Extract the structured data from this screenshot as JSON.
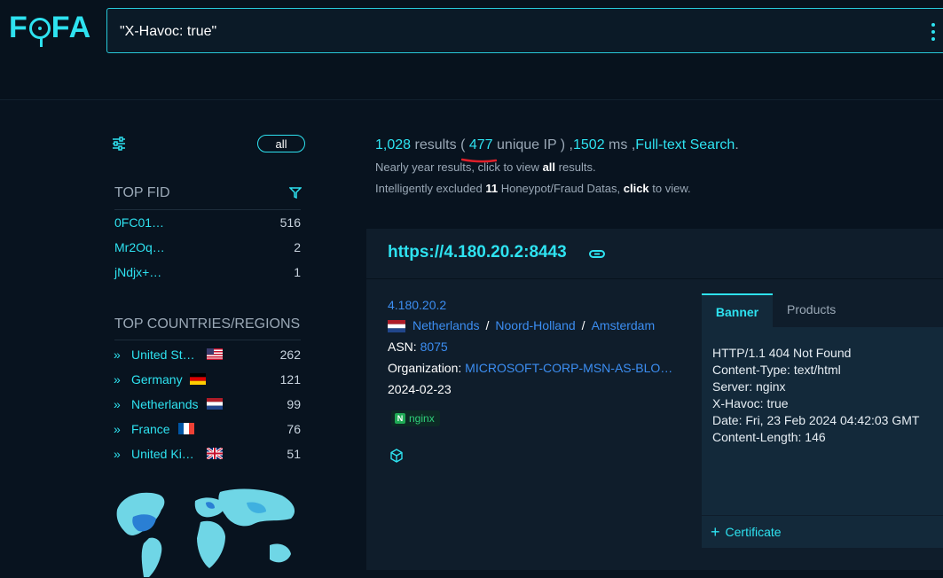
{
  "app": {
    "logo": "FOFA"
  },
  "search": {
    "query": "\"X-Havoc: true\""
  },
  "sidebar": {
    "all_label": "all",
    "top_fid": {
      "title": "TOP FID",
      "items": [
        {
          "label": "0FC01…",
          "count": "516"
        },
        {
          "label": "Mr2Oq…",
          "count": "2"
        },
        {
          "label": "jNdjx+…",
          "count": "1"
        }
      ]
    },
    "top_countries": {
      "title": "TOP COUNTRIES/REGIONS",
      "items": [
        {
          "label": "United St…",
          "flag": "us-flag",
          "count": "262"
        },
        {
          "label": "Germany",
          "flag": "de-flag",
          "count": "121"
        },
        {
          "label": "Netherlands",
          "flag": "nl-flag",
          "count": "99"
        },
        {
          "label": "France",
          "flag": "fr-flag",
          "count": "76"
        },
        {
          "label": "United Ki…",
          "flag": "gb-flag",
          "count": "51"
        }
      ]
    }
  },
  "summary": {
    "results_count": "1,028",
    "results_word": "results (",
    "unique_ip_count": "477",
    "unique_ip_word": "unique IP ) ,",
    "ms_value": "1502",
    "ms_word": "ms ,",
    "fulltext_link": "Full-text Search",
    "period": ".",
    "line2_pre": "Nearly year results, click to view",
    "line2_all": "all",
    "line2_post": "results.",
    "line3_pre": "Intelligently excluded",
    "line3_count": "11",
    "line3_mid": "Honeypot/Fraud Datas,",
    "line3_click": "click",
    "line3_post": "to view."
  },
  "result": {
    "url": "https://4.180.20.2:8443",
    "ip": "4.180.20.2",
    "country": "Netherlands",
    "sep": "/",
    "region": "Noord-Holland",
    "city": "Amsterdam",
    "asn_label": "ASN:",
    "asn_value": "8075",
    "org_label": "Organization:",
    "org_value": "MICROSOFT-CORP-MSN-AS-BLO…",
    "date": "2024-02-23",
    "tag": "nginx",
    "tabs": {
      "banner": "Banner",
      "products": "Products"
    },
    "banner_lines": "HTTP/1.1 404 Not Found\nContent-Type: text/html\nServer: nginx\nX-Havoc: true\nDate: Fri, 23 Feb 2024 04:42:03 GMT\nContent-Length: 146",
    "certificate_label": "Certificate"
  },
  "colors": {
    "accent": "#2ee2f0",
    "link": "#3c8ef2",
    "background": "#08131f"
  }
}
